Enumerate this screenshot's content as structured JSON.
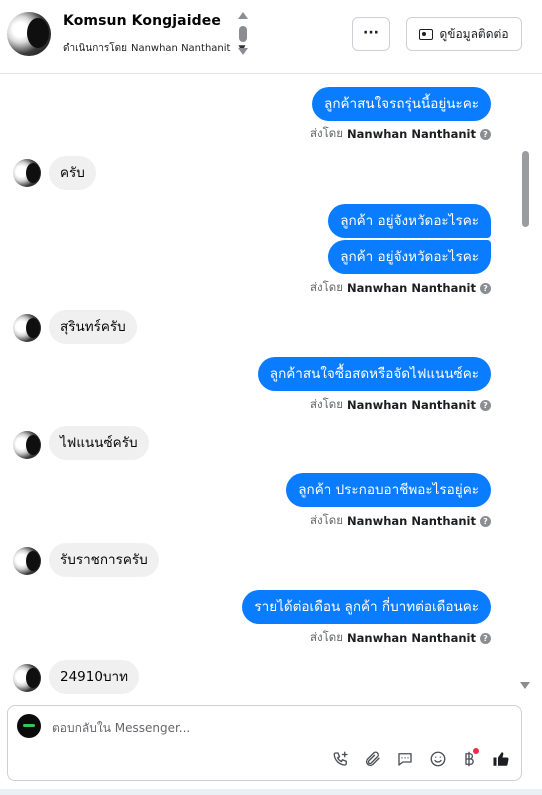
{
  "header": {
    "contact_name": "Komsun Kongjaidee",
    "assigned_prefix": "ดำเนินการโดย",
    "assigned_to": "Nanwhan Nanthanit",
    "more_label": "···",
    "contact_info_label": "ดูข้อมูลติดต่อ"
  },
  "messages": [
    {
      "text": "ลูกค้าสนใจรถรุ่นนี้อยู่นะคะ"
    },
    {
      "text": "ครับ"
    },
    {
      "text": "ลูกค้า อยู่จังหวัดอะไรคะ"
    },
    {
      "text": "ลูกค้า อยู่จังหวัดอะไรคะ"
    },
    {
      "text": "สุรินทร์ครับ"
    },
    {
      "text": "ลูกค้าสนใจซื้อสดหรือจัดไฟแนนซ์คะ"
    },
    {
      "text": "ไฟแนนซ์ครับ"
    },
    {
      "text": "ลูกค้า ประกอบอาชีพอะไรอยู่คะ"
    },
    {
      "text": "รับราชการครับ"
    },
    {
      "text": "รายได้ต่อเดือน ลูกค้า กี่บาทต่อเดือนคะ"
    },
    {
      "text": "24910บาท"
    }
  ],
  "sent_by": {
    "prefix": "ส่งโดย",
    "name": "Nanwhan Nanthanit"
  },
  "composer": {
    "placeholder": "ตอบกลับใน Messenger..."
  },
  "icons": {
    "call": "phone-add-icon",
    "attach": "paperclip-icon",
    "saved_replies": "chat-bubble-icon",
    "emoji": "emoji-icon",
    "payment": "baht-icon",
    "like": "thumbs-up-icon"
  },
  "colors": {
    "outgoing_bubble": "#0a7cff",
    "incoming_bubble": "#f0f0f0",
    "badge": "#f02849"
  }
}
